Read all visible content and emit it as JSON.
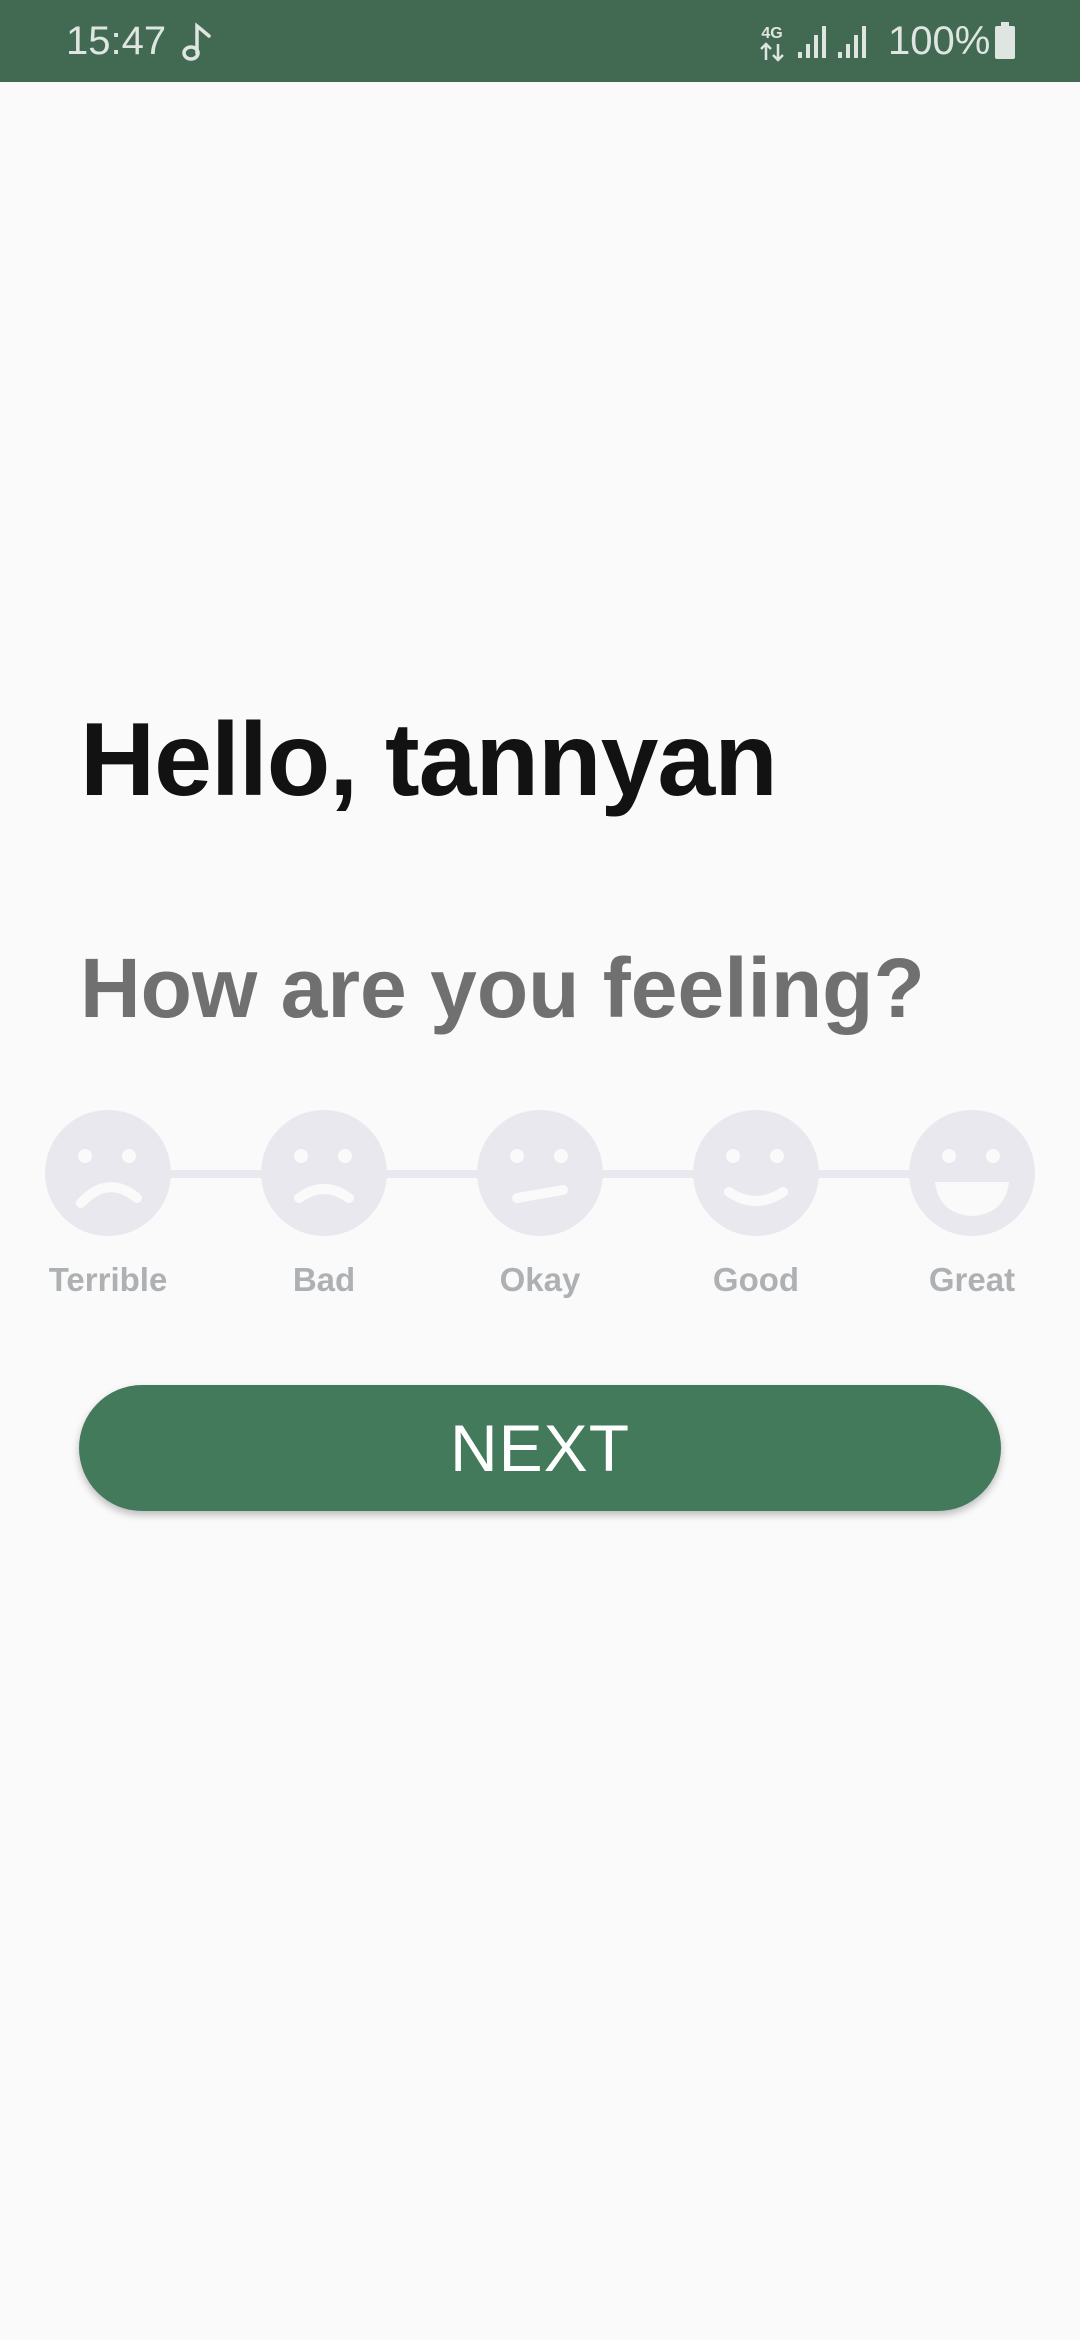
{
  "status_bar": {
    "time": "15:47",
    "network_type": "4G",
    "battery_percent": "100%",
    "icons": [
      "music-note-icon",
      "network-4g-icon",
      "signal-icon",
      "signal-icon",
      "battery-icon"
    ],
    "background_color": "#426a52"
  },
  "greeting": "Hello, tannyan",
  "question": "How are you feeling?",
  "moods": [
    {
      "label": "Terrible",
      "icon": "terrible-face-icon"
    },
    {
      "label": "Bad",
      "icon": "bad-face-icon"
    },
    {
      "label": "Okay",
      "icon": "okay-face-icon"
    },
    {
      "label": "Good",
      "icon": "good-face-icon"
    },
    {
      "label": "Great",
      "icon": "great-face-icon"
    }
  ],
  "next_button": {
    "label": "NEXT",
    "color": "#437a5b"
  }
}
